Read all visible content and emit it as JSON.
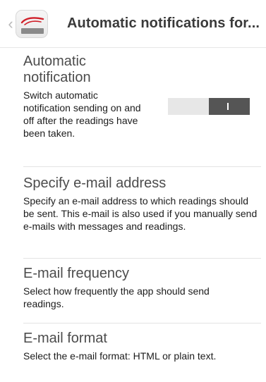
{
  "header": {
    "back_glyph": "‹",
    "logo_text": "CONNECT",
    "logo_script": "jura",
    "title": "Automatic notifications for..."
  },
  "sections": [
    {
      "title_line1": "Automatic",
      "title_line2": "notification",
      "description": "Switch automatic notification sending on and off after the readings have been taken.",
      "toggle": {
        "state": "on",
        "on_symbol": "I"
      }
    },
    {
      "title": "Specify e-mail address",
      "description": "Specify an e-mail address to which readings should be sent. This e-mail is also used if you manually send e-mails with messages and readings."
    },
    {
      "title": "E-mail frequency",
      "description": "Select how frequently the app should send readings."
    },
    {
      "title": "E-mail format",
      "description": "Select the e-mail format: HTML or plain text."
    }
  ],
  "colors": {
    "logo_red": "#d0202a",
    "toggle_on": "#555555",
    "toggle_off": "#e7e7e7"
  }
}
